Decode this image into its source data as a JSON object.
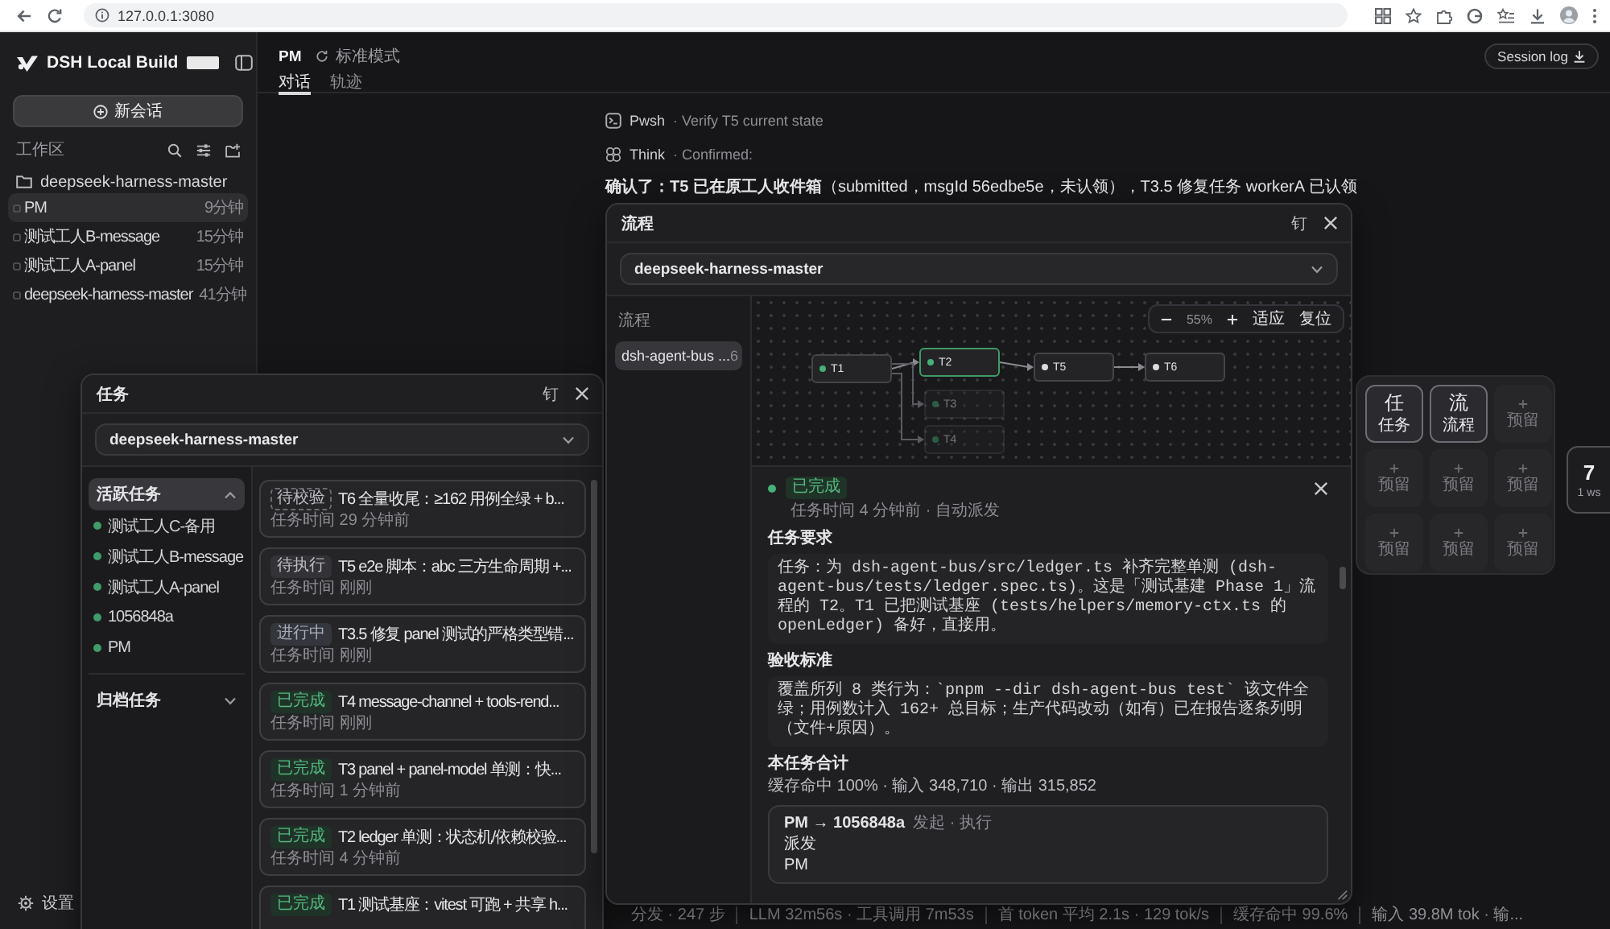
{
  "browser": {
    "url": "127.0.0.1:3080"
  },
  "sidebar": {
    "brand": "DSH Local Build",
    "new_session": "新会话",
    "section": "工作区",
    "workspace": "deepseek-harness-master",
    "sessions": [
      {
        "name": "PM",
        "age": "9分钟",
        "selected": true
      },
      {
        "name": "测试工人B-message",
        "age": "15分钟",
        "selected": false
      },
      {
        "name": "测试工人A-panel",
        "age": "15分钟",
        "selected": false
      },
      {
        "name": "deepseek-harness-master",
        "age": "41分钟",
        "selected": false
      }
    ],
    "settings": "设置"
  },
  "header": {
    "title": "PM",
    "mode": "标准模式",
    "tabs": [
      {
        "label": "对话",
        "selected": true
      },
      {
        "label": "轨迹",
        "selected": false
      }
    ],
    "session_log": "Session log"
  },
  "chat": {
    "steps": [
      {
        "kind": "terminal",
        "tool": "Pwsh",
        "detail": "· Verify T5 current state"
      },
      {
        "kind": "think",
        "tool": "Think",
        "detail": "· Confirmed:"
      }
    ],
    "message": "**确认了：T5 已在原工人收件箱**（submitted，msgId 56edbe5e，未认领），T3.5 修复任务 workerA 已认领"
  },
  "task_panel": {
    "title": "任务",
    "pin": "钉",
    "project": "deepseek-harness-master",
    "groups": [
      {
        "label": "活跃任务",
        "selected": true,
        "expanded": true,
        "workers": [
          "测试工人C-备用",
          "测试工人B-message",
          "测试工人A-panel",
          "1056848a",
          "PM"
        ]
      },
      {
        "label": "归档任务",
        "selected": false,
        "expanded": false
      }
    ],
    "tasks": [
      {
        "kind": "verify",
        "badge": "待校验",
        "title": "T6 全量收尾：≥162 用例全绿 + b...",
        "time": "任务时间 29 分钟前"
      },
      {
        "kind": "todo",
        "badge": "待执行",
        "title": "T5 e2e 脚本：abc 三方生命周期 +...",
        "time": "任务时间 刚刚"
      },
      {
        "kind": "doing",
        "badge": "进行中",
        "title": "T3.5 修复 panel 测试的严格类型错...",
        "time": "任务时间 刚刚"
      },
      {
        "kind": "done",
        "badge": "已完成",
        "title": "T4 message-channel + tools-rend...",
        "time": "任务时间 刚刚"
      },
      {
        "kind": "done",
        "badge": "已完成",
        "title": "T3 panel + panel-model 单测：快...",
        "time": "任务时间 1 分钟前"
      },
      {
        "kind": "done",
        "badge": "已完成",
        "title": "T2 ledger 单测：状态机/依赖校验...",
        "time": "任务时间 4 分钟前"
      },
      {
        "kind": "done",
        "badge": "已完成",
        "title": "T1 测试基座：vitest 可跑 + 共享 h..."
      }
    ]
  },
  "flow_panel": {
    "title": "流程",
    "pin": "钉",
    "project": "deepseek-harness-master",
    "list_label": "流程",
    "flows": [
      {
        "name": "dsh-agent-bus ...",
        "count": "6",
        "selected": true
      }
    ],
    "zoom": {
      "level": "55%",
      "fit": "适应",
      "reset": "复位"
    },
    "nodes": [
      {
        "label": "T1",
        "kind": "done",
        "selected": false,
        "faded": false
      },
      {
        "label": "T2",
        "kind": "done",
        "selected": true,
        "faded": false
      },
      {
        "label": "T5",
        "kind": "todo",
        "selected": false,
        "faded": false
      },
      {
        "label": "T6",
        "kind": "verify",
        "selected": false,
        "faded": false
      },
      {
        "label": "T3",
        "kind": "done",
        "selected": false,
        "faded": true
      },
      {
        "label": "T4",
        "kind": "done",
        "selected": false,
        "faded": true
      }
    ],
    "detail": {
      "kind": "done",
      "badge": "已完成",
      "meta": "任务时间 4 分钟前 · 自动派发",
      "sections": [
        {
          "heading": "任务要求",
          "body": "任务：为 dsh-agent-bus/src/ledger.ts 补齐完整单测 (dsh-agent-bus/tests/ledger.spec.ts)。这是「测试基建 Phase 1」流程的 T2。T1 已把测试基座 (tests/helpers/memory-ctx.ts 的 openLedger) 备好，直接用。"
        },
        {
          "heading": "验收标准",
          "body": "覆盖所列 8 类行为：`pnpm --dir dsh-agent-bus test` 该文件全绿；用例数计入 162+ 总目标；生产代码改动（如有）已在报告逐条列明（文件+原因）。"
        }
      ],
      "totals_heading": "本任务合计",
      "totals": "缓存命中 100% · 输入 348,710 · 输出 315,852",
      "event": {
        "route": "PM → 1056848a",
        "meta": "发起 · 执行",
        "action": "派发",
        "actor": "PM"
      }
    }
  },
  "dock": {
    "tiles": [
      {
        "kind": "panel",
        "glyph": "任",
        "label": "任务"
      },
      {
        "kind": "panel",
        "glyph": "流",
        "label": "流程"
      },
      {
        "kind": "slot",
        "label": "预留"
      },
      {
        "kind": "slot",
        "label": "预留"
      },
      {
        "kind": "slot",
        "label": "预留"
      },
      {
        "kind": "slot",
        "label": "预留"
      },
      {
        "kind": "slot",
        "label": "预留"
      },
      {
        "kind": "slot",
        "label": "预留"
      },
      {
        "kind": "slot",
        "label": "预留"
      }
    ]
  },
  "workspace_tab": {
    "count": "7",
    "label": "1 ws"
  },
  "status_bar": [
    "分发 · 247 步",
    "LLM 32m56s · 工具调用 7m53s",
    "首 token 平均 2.1s · 129 tok/s",
    "缓存命中 99.6%",
    "输入 39.8M tok · 输..."
  ]
}
